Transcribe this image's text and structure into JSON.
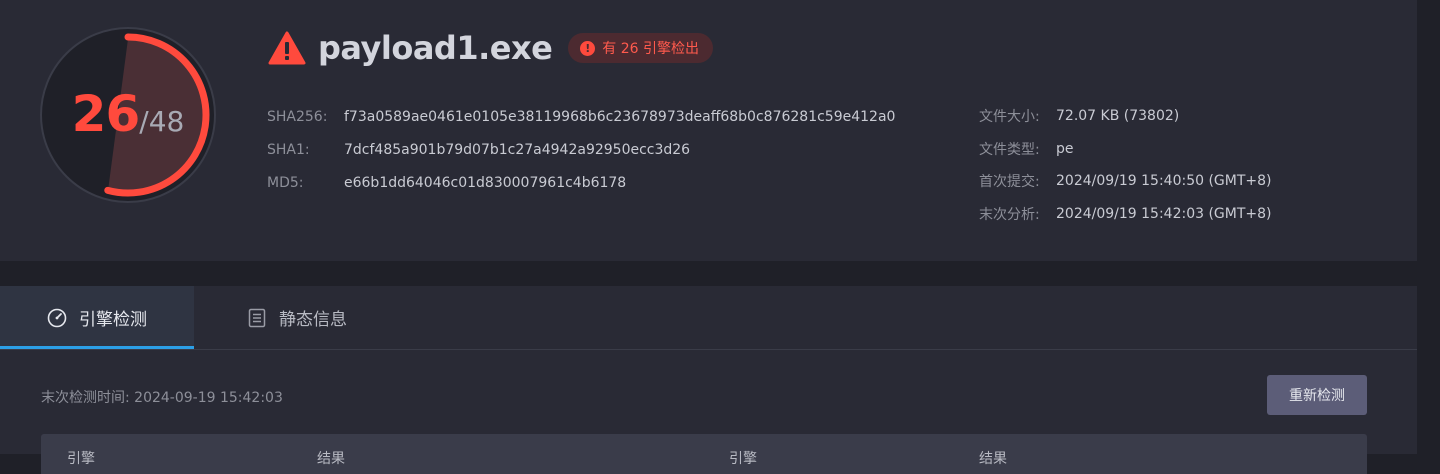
{
  "score": {
    "detected": "26",
    "total": "/48",
    "fraction": 0.5417
  },
  "file": {
    "name": "payload1.exe",
    "badge": "有 26 引擎检出"
  },
  "hashes": [
    {
      "key": "SHA256:",
      "value": "f73a0589ae0461e0105e38119968b6c23678973deaff68b0c876281c59e412a0"
    },
    {
      "key": "SHA1:",
      "value": "7dcf485a901b79d07b1c27a4942a92950ecc3d26"
    },
    {
      "key": "MD5:",
      "value": "e66b1dd64046c01d830007961c4b6178"
    }
  ],
  "meta": [
    {
      "key": "文件大小:",
      "value": "72.07 KB (73802)"
    },
    {
      "key": "文件类型:",
      "value": "pe"
    },
    {
      "key": "首次提交:",
      "value": "2024/09/19 15:40:50 (GMT+8)"
    },
    {
      "key": "末次分析:",
      "value": "2024/09/19 15:42:03 (GMT+8)"
    }
  ],
  "tabs": [
    {
      "label": "引擎检测",
      "icon": "gauge-icon",
      "active": true
    },
    {
      "label": "静态信息",
      "icon": "list-icon",
      "active": false
    }
  ],
  "detection": {
    "last_time": "末次检测时间: 2024-09-19 15:42:03",
    "redetect_label": "重新检测"
  },
  "table": {
    "headers": [
      "引擎",
      "结果",
      "引擎",
      "结果"
    ]
  },
  "colors": {
    "danger": "#ff4a3d",
    "accent": "#2c9fe6",
    "panel": "#292a35",
    "background": "#1f2028"
  }
}
